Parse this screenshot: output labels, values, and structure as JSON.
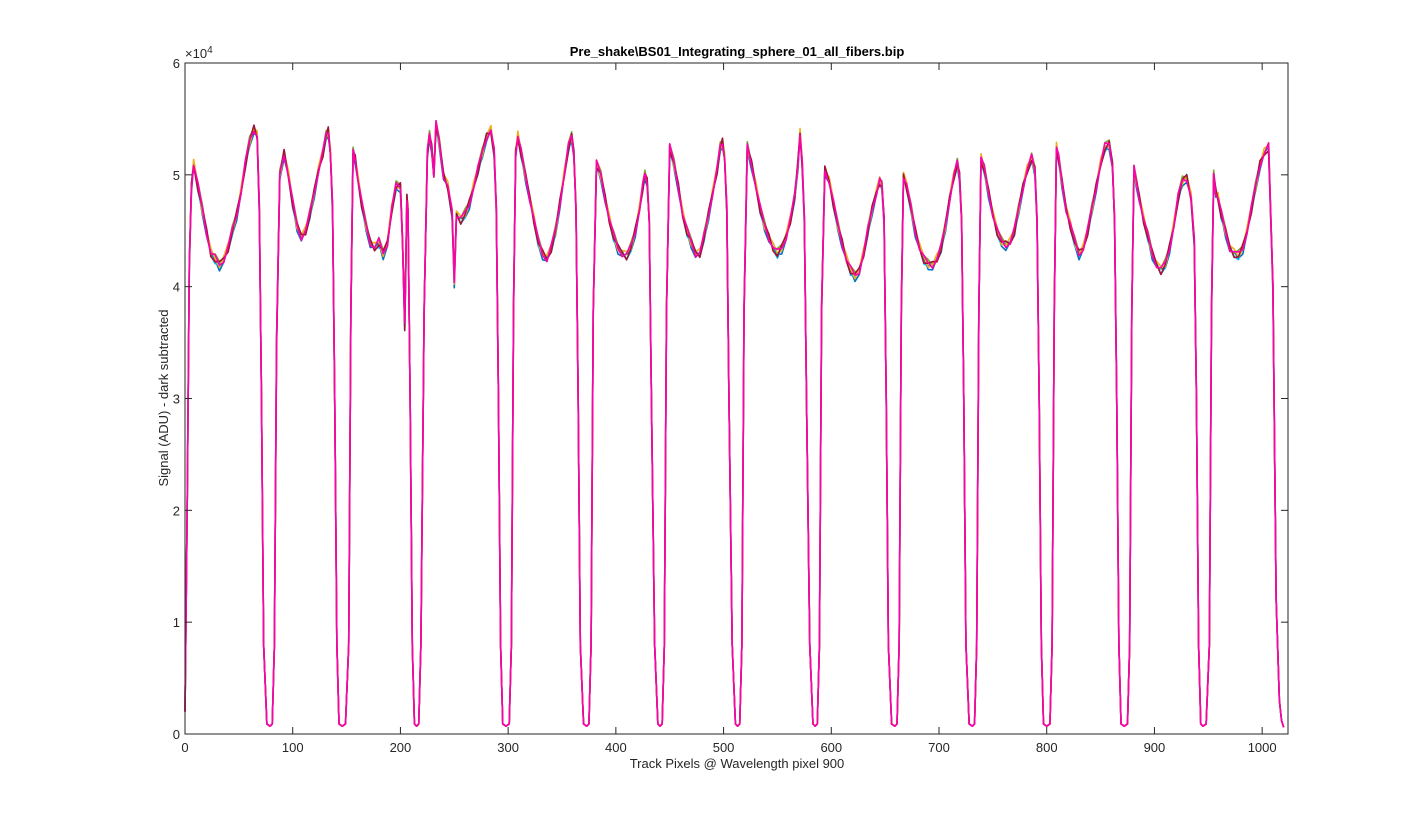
{
  "chart_data": {
    "type": "line",
    "title": "Pre_shake\\BS01_Integrating_sphere_01_all_fibers.bip",
    "xlabel": "Track Pixels @ Wavelength pixel 900",
    "ylabel": "Signal (ADU) - dark subtracted",
    "xlim": [
      0,
      1024
    ],
    "ylim": [
      0,
      60000
    ],
    "x_ticks": [
      0,
      100,
      200,
      300,
      400,
      500,
      600,
      700,
      800,
      900,
      1000
    ],
    "y_ticks": [
      0,
      10000,
      20000,
      30000,
      40000,
      50000,
      60000
    ],
    "y_tick_labels": [
      "0",
      "1",
      "2",
      "3",
      "4",
      "5",
      "6"
    ],
    "y_exponent_label": "×10",
    "y_exponent_power": "4",
    "box": true,
    "grid": false,
    "series": [
      {
        "color": "#0072BD",
        "offset": -250
      },
      {
        "color": "#00B4FF",
        "offset": -120
      },
      {
        "color": "#77AC30",
        "offset": 120
      },
      {
        "color": "#EDB120",
        "offset": 60
      },
      {
        "color": "#A2142F",
        "offset": -60
      },
      {
        "color": "#FF00B0",
        "offset": 0
      }
    ],
    "profile": {
      "x": [
        0,
        2,
        4,
        6,
        8,
        12,
        16,
        20,
        24,
        28,
        32,
        36,
        40,
        44,
        48,
        52,
        56,
        60,
        64,
        67,
        69,
        71,
        73,
        76,
        79,
        81,
        83,
        85,
        88,
        92,
        96,
        100,
        104,
        108,
        112,
        116,
        120,
        124,
        128,
        131,
        133,
        135,
        137,
        139,
        141,
        143,
        146,
        149,
        152,
        154,
        156,
        158,
        160,
        164,
        168,
        172,
        176,
        180,
        184,
        188,
        192,
        196,
        200,
        202,
        204,
        205,
        206,
        207,
        209,
        211,
        213,
        215,
        217,
        219,
        222,
        225,
        227,
        229,
        231,
        233,
        236,
        240,
        244,
        248,
        250,
        252,
        256,
        260,
        264,
        268,
        272,
        276,
        280,
        284,
        287,
        289,
        291,
        293,
        295,
        298,
        301,
        303,
        305,
        307,
        309,
        312,
        316,
        320,
        324,
        328,
        332,
        336,
        340,
        344,
        348,
        352,
        356,
        359,
        361,
        363,
        365,
        367,
        370,
        373,
        375,
        377,
        379,
        382,
        386,
        390,
        394,
        398,
        402,
        406,
        410,
        414,
        418,
        422,
        425,
        427,
        429,
        431,
        433,
        436,
        439,
        441,
        443,
        445,
        447,
        450,
        454,
        458,
        462,
        466,
        470,
        474,
        478,
        482,
        486,
        490,
        494,
        497,
        499,
        501,
        503,
        505,
        508,
        511,
        513,
        515,
        517,
        519,
        522,
        526,
        530,
        534,
        538,
        542,
        546,
        550,
        554,
        558,
        562,
        566,
        569,
        571,
        573,
        575,
        577,
        580,
        583,
        585,
        587,
        589,
        591,
        594,
        598,
        602,
        606,
        610,
        614,
        618,
        622,
        626,
        630,
        634,
        638,
        642,
        645,
        647,
        649,
        651,
        653,
        656,
        659,
        661,
        663,
        665,
        667,
        670,
        674,
        678,
        682,
        686,
        690,
        694,
        698,
        702,
        706,
        710,
        714,
        717,
        719,
        721,
        723,
        725,
        728,
        731,
        733,
        735,
        737,
        739,
        742,
        746,
        750,
        754,
        758,
        762,
        766,
        770,
        774,
        778,
        782,
        786,
        789,
        791,
        793,
        795,
        797,
        800,
        803,
        805,
        807,
        809,
        811,
        814,
        818,
        822,
        826,
        830,
        834,
        838,
        842,
        846,
        850,
        854,
        858,
        861,
        863,
        865,
        867,
        869,
        872,
        875,
        877,
        879,
        881,
        883,
        886,
        890,
        894,
        898,
        902,
        906,
        910,
        914,
        918,
        922,
        926,
        930,
        934,
        937,
        939,
        941,
        943,
        945,
        948,
        951,
        953,
        955,
        957,
        959,
        962,
        966,
        970,
        974,
        978,
        982,
        986,
        990,
        994,
        998,
        1002,
        1006,
        1010,
        1013,
        1016,
        1018,
        1020,
        1022,
        1024
      ],
      "y": [
        2000,
        20000,
        42000,
        49000,
        51000,
        49000,
        47000,
        45000,
        43000,
        42500,
        42000,
        42500,
        43500,
        45000,
        46500,
        48500,
        51000,
        53000,
        54200,
        53500,
        47000,
        30000,
        8000,
        900,
        700,
        900,
        8000,
        35000,
        50000,
        52000,
        50000,
        47500,
        45500,
        44500,
        45000,
        46500,
        48500,
        50500,
        52000,
        53500,
        54000,
        52000,
        47000,
        30000,
        8000,
        900,
        700,
        900,
        8000,
        38000,
        52000,
        51500,
        50000,
        47500,
        45500,
        44000,
        43500,
        44000,
        43000,
        44000,
        47000,
        49000,
        49000,
        44000,
        36500,
        42000,
        48000,
        47000,
        30000,
        8000,
        900,
        700,
        900,
        8000,
        38000,
        52000,
        53500,
        52500,
        50000,
        54500,
        53000,
        50000,
        49000,
        46500,
        40500,
        46500,
        46000,
        46500,
        47500,
        49000,
        50500,
        52000,
        53500,
        54000,
        52000,
        47000,
        30000,
        8000,
        900,
        700,
        900,
        8000,
        38000,
        52000,
        53500,
        52000,
        50000,
        48000,
        46000,
        44000,
        43000,
        42500,
        43500,
        45000,
        47500,
        50000,
        52500,
        53500,
        52000,
        47000,
        30000,
        8000,
        900,
        700,
        900,
        8000,
        38000,
        51000,
        50000,
        48000,
        46000,
        44500,
        43500,
        43000,
        42800,
        43500,
        45000,
        47000,
        49000,
        50000,
        49500,
        46000,
        30000,
        8000,
        900,
        700,
        900,
        8000,
        38000,
        52500,
        51000,
        49000,
        46500,
        45000,
        44000,
        43000,
        43000,
        44500,
        46500,
        48500,
        50500,
        52500,
        53000,
        51500,
        47000,
        30000,
        8000,
        900,
        700,
        900,
        8000,
        38000,
        52500,
        51000,
        49000,
        47000,
        45500,
        44500,
        43500,
        43000,
        43500,
        44500,
        46000,
        48000,
        51000,
        53800,
        51000,
        46000,
        30000,
        8000,
        900,
        700,
        900,
        8000,
        38000,
        50500,
        49500,
        47500,
        45500,
        44000,
        42500,
        41500,
        41000,
        41500,
        43000,
        45000,
        47000,
        48500,
        49500,
        49000,
        46000,
        30000,
        8000,
        900,
        700,
        900,
        8000,
        38000,
        50000,
        49000,
        47000,
        45000,
        43500,
        42500,
        42000,
        42000,
        42500,
        43500,
        45500,
        48000,
        50000,
        51000,
        50000,
        46000,
        30000,
        8000,
        900,
        700,
        900,
        8000,
        38000,
        51500,
        50500,
        48500,
        46500,
        45000,
        44000,
        43800,
        44000,
        45000,
        47000,
        49000,
        50500,
        51500,
        50500,
        46000,
        30000,
        8000,
        900,
        700,
        900,
        8000,
        38000,
        52500,
        51500,
        49500,
        47000,
        45500,
        44000,
        43000,
        43500,
        45000,
        47000,
        49000,
        51000,
        52500,
        52800,
        51000,
        46000,
        30000,
        8000,
        900,
        700,
        900,
        8000,
        38000,
        50500,
        49500,
        48000,
        46000,
        44500,
        43000,
        42000,
        41500,
        42000,
        43500,
        45500,
        48000,
        49500,
        49800,
        48000,
        44000,
        30000,
        8000,
        900,
        700,
        900,
        8000,
        38000,
        50000,
        48500,
        48000,
        46500,
        45000,
        43500,
        43000,
        42800,
        43500,
        45000,
        47000,
        49000,
        51000,
        52000,
        52500,
        40000,
        12000,
        3000,
        1200,
        600
      ]
    }
  }
}
